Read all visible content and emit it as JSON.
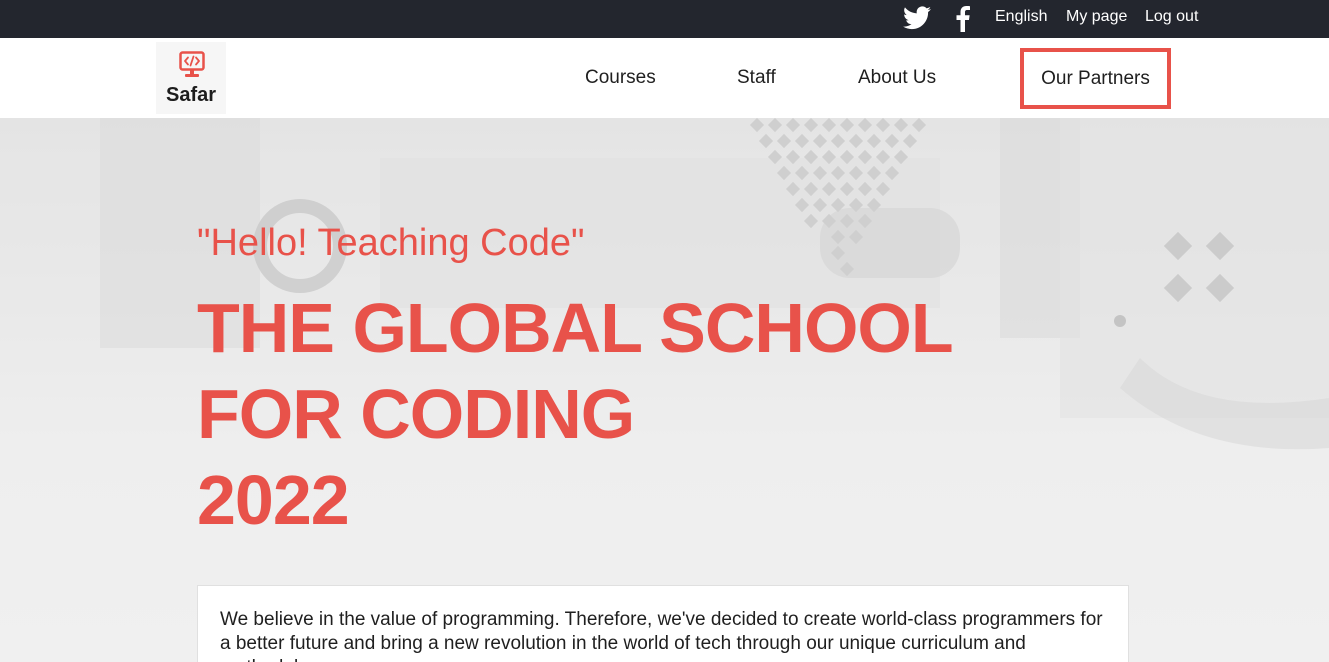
{
  "topbar": {
    "social": [
      {
        "icon": "twitter-icon"
      },
      {
        "icon": "facebook-icon"
      }
    ],
    "language": "English",
    "my_page": "My page",
    "log_out": "Log out"
  },
  "logo": {
    "icon": "code-monitor-icon",
    "text": "Safar",
    "color": "#e8524a"
  },
  "nav": {
    "courses": "Courses",
    "staff": "Staff",
    "about": "About Us",
    "partners": "Our Partners"
  },
  "hero": {
    "quote": "\"Hello! Teaching Code\"",
    "headline": [
      "THE GLOBAL SCHOOL",
      "FOR CODING",
      "2022"
    ],
    "intro": "We believe in the value of programming. Therefore, we've decided to create world-class programmers for a better future and bring a new revolution in the world of tech through our unique curriculum and methodology."
  },
  "colors": {
    "accent": "#e8524a",
    "topbar_bg": "#23262e"
  }
}
